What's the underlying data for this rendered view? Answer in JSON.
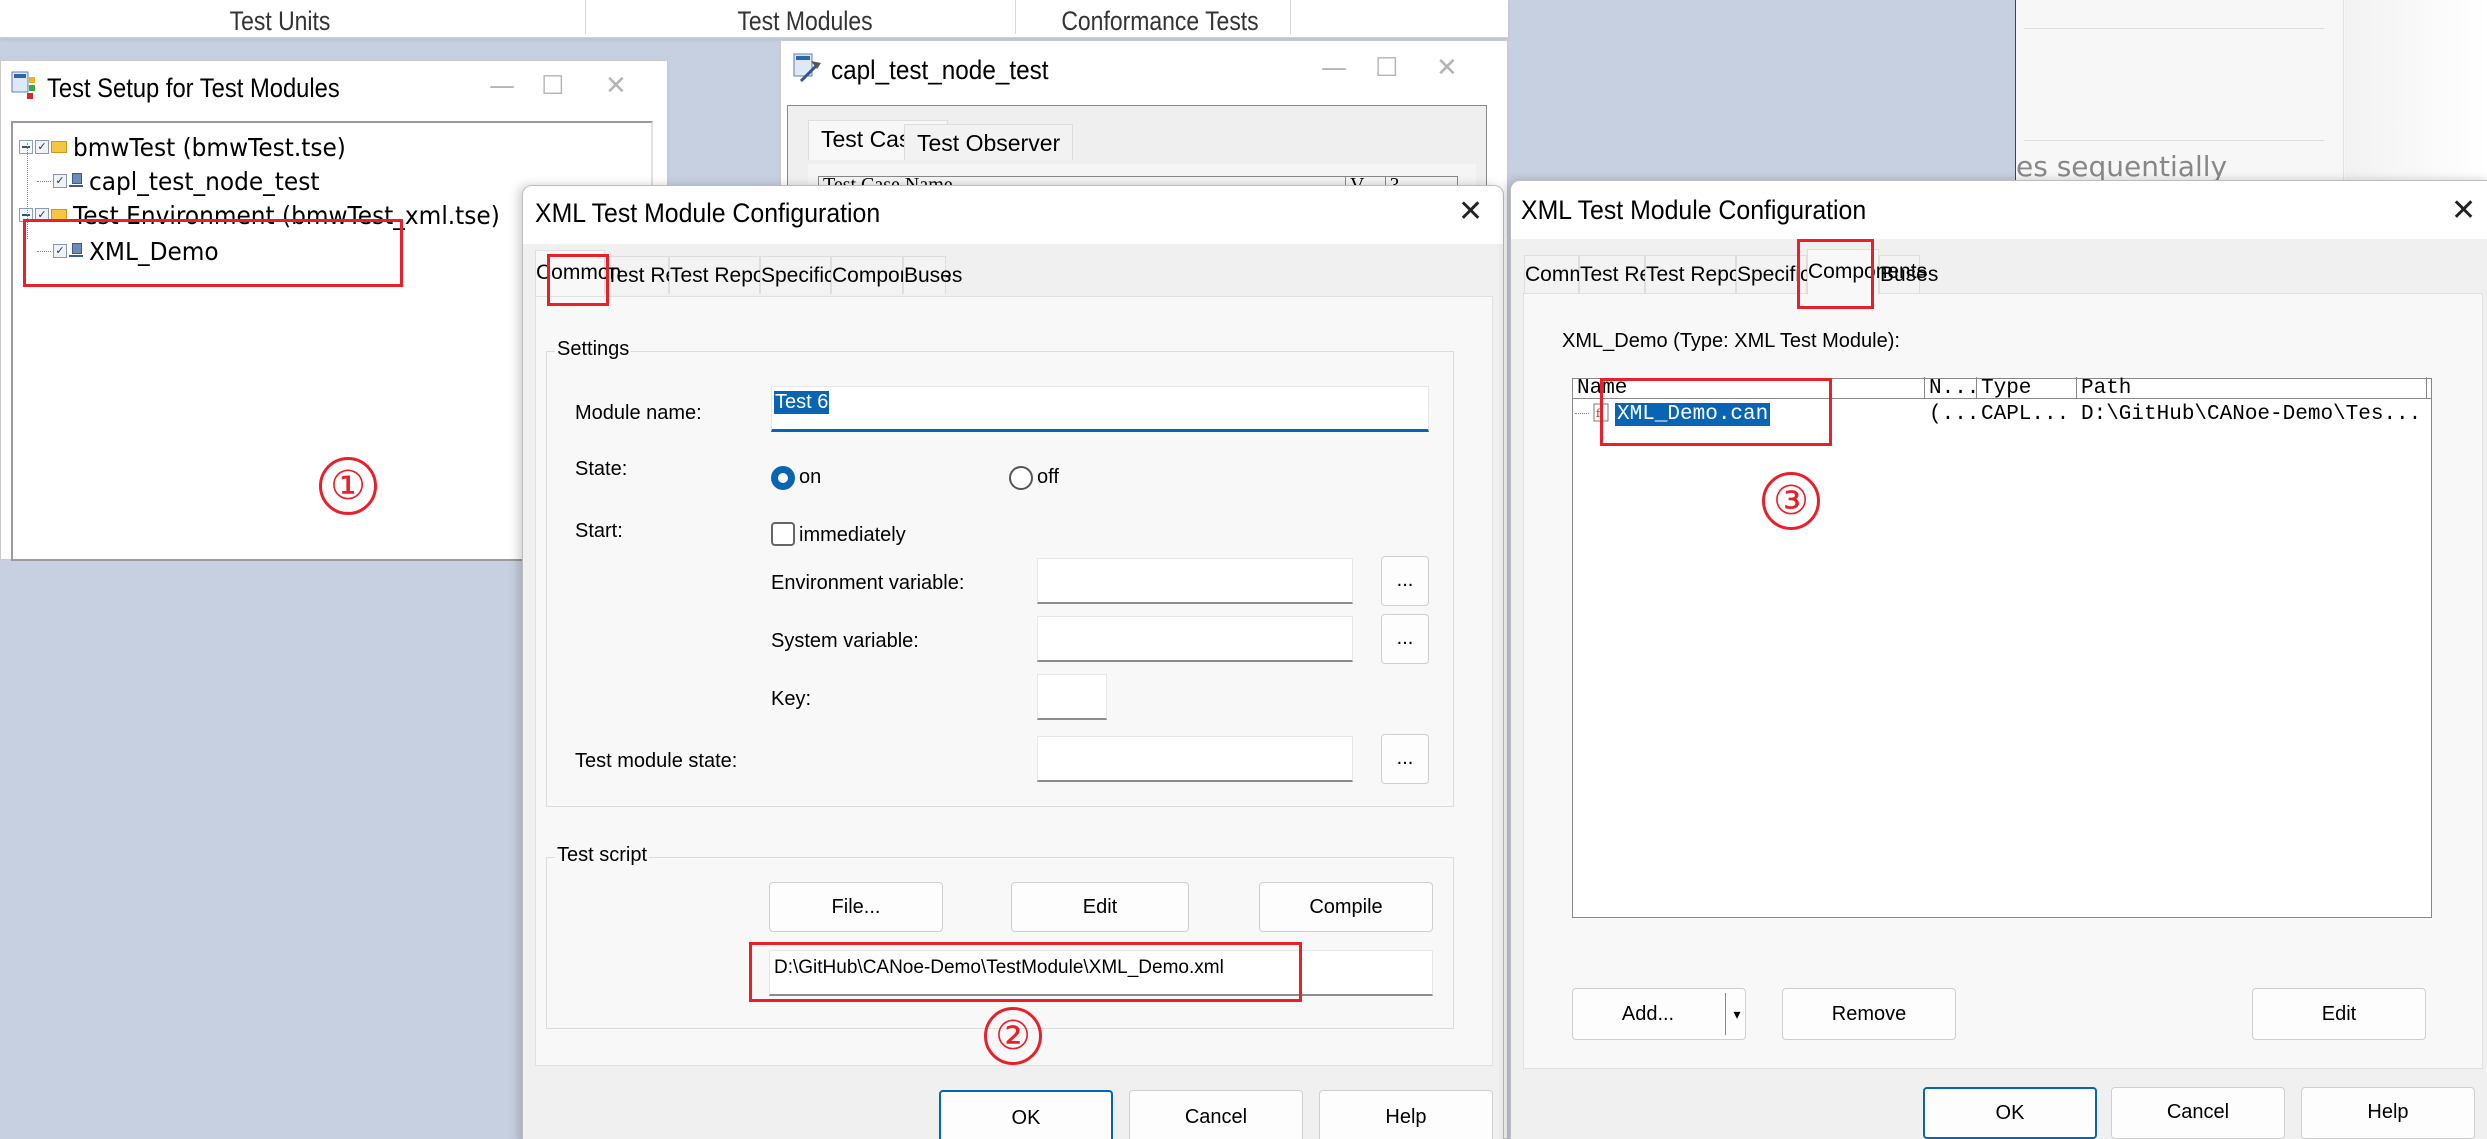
{
  "background_app": {
    "top_tabs": [
      "Test Units",
      "Test Modules",
      "Conformance Tests"
    ],
    "right_panel_text": "es sequentially"
  },
  "setup_window": {
    "title": "Test Setup for Test Modules",
    "controls": {
      "minimize": "—",
      "maximize": "☐",
      "close": "✕"
    },
    "tree": [
      {
        "label": "bmwTest  (bmwTest.tse)",
        "type": "folder",
        "checked": true,
        "expanded": true,
        "level": 0
      },
      {
        "label": "capl_test_node_test",
        "type": "test-module",
        "checked": true,
        "level": 1
      },
      {
        "label": "Test Environment  (bmwTest_xml.tse)",
        "type": "folder",
        "checked": true,
        "expanded": true,
        "level": 0
      },
      {
        "label": "XML_Demo",
        "type": "test-module",
        "checked": true,
        "level": 1
      }
    ]
  },
  "capl_window": {
    "title": "capl_test_node_test",
    "controls": {
      "minimize": "—",
      "maximize": "☐",
      "close": "✕"
    },
    "tabs": [
      "Test Cases",
      "Test Observer"
    ],
    "active_tab": "Test Cases",
    "list_header": [
      "Test Case Name",
      "V...",
      "?..."
    ]
  },
  "dialog_common": {
    "title": "XML Test Module Configuration",
    "close": "✕",
    "tabs": [
      "Common",
      "Test Report",
      "Test Report Filter",
      "Specification",
      "Components",
      "Buses"
    ],
    "active_tab": "Common",
    "settings": {
      "group_label": "Settings",
      "module_name_label": "Module name:",
      "module_name_value": "Test 6",
      "state_label": "State:",
      "state_on": "on",
      "state_off": "off",
      "state_value": "on",
      "start_label": "Start:",
      "immediately_label": "immediately",
      "immediately_checked": false,
      "env_var_label": "Environment variable:",
      "env_var_value": "",
      "sys_var_label": "System variable:",
      "sys_var_value": "",
      "key_label": "Key:",
      "key_value": "",
      "module_state_label": "Test module state:",
      "module_state_value": "",
      "browse": "..."
    },
    "test_script": {
      "group_label": "Test script",
      "file_button": "File...",
      "edit_button": "Edit",
      "compile_button": "Compile",
      "path": "D:\\GitHub\\CANoe-Demo\\TestModule\\XML_Demo.xml"
    },
    "buttons": {
      "ok": "OK",
      "cancel": "Cancel",
      "help": "Help"
    }
  },
  "dialog_components": {
    "title": "XML Test Module Configuration",
    "close": "✕",
    "tabs": [
      "Common",
      "Test Report",
      "Test Report Filter",
      "Specification",
      "Components",
      "Buses"
    ],
    "active_tab": "Components",
    "heading": "XML_Demo (Type: XML Test Module):",
    "columns": [
      "Name",
      "N...",
      "Type",
      "Path"
    ],
    "rows": [
      {
        "name": "XML_Demo.can",
        "n": "(...",
        "type": "CAPL...",
        "path": "D:\\GitHub\\CANoe-Demo\\Tes...",
        "selected": true
      }
    ],
    "add_button": "Add...",
    "add_dropdown": "▾",
    "remove_button": "Remove",
    "edit_button": "Edit",
    "buttons": {
      "ok": "OK",
      "cancel": "Cancel",
      "help": "Help"
    }
  },
  "annotations": {
    "step1": "①",
    "step2": "②",
    "step3": "③",
    "color": "#e8202a"
  },
  "colors": {
    "accent": "#0a64b4",
    "desktop_bg": "#c7d0e0",
    "annotation_red": "#e8202a"
  }
}
